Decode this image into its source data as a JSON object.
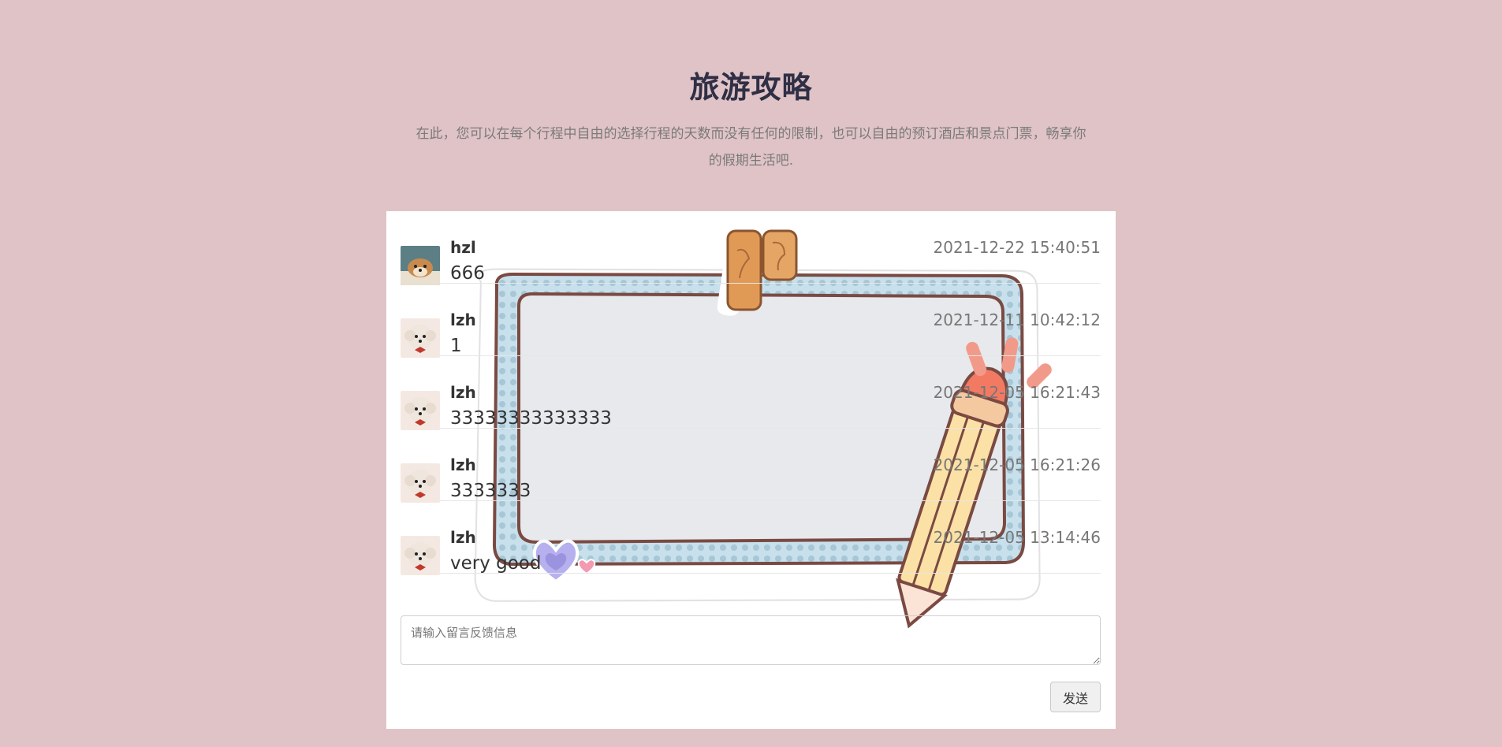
{
  "header": {
    "title": "旅游攻略",
    "subtitle": "在此，您可以在每个行程中自由的选择行程的天数而没有任何的限制，也可以自由的预订酒店和景点门票，畅享你的假期生活吧."
  },
  "messages": [
    {
      "user": "hzl",
      "text": "666",
      "time": "2021-12-22 15:40:51",
      "avatar": "shiba-dog-avatar"
    },
    {
      "user": "lzh",
      "text": "1",
      "time": "2021-12-11 10:42:12",
      "avatar": "poodle-avatar"
    },
    {
      "user": "lzh",
      "text": "33333333333333",
      "time": "2021-12-05 16:21:43",
      "avatar": "poodle-avatar"
    },
    {
      "user": "lzh",
      "text": "3333333",
      "time": "2021-12-05 16:21:26",
      "avatar": "poodle-avatar"
    },
    {
      "user": "lzh",
      "text": "very good",
      "time": "2021-12-05 13:14:46",
      "avatar": "poodle-avatar"
    }
  ],
  "form": {
    "placeholder": "请输入留言反馈信息",
    "send_label": "发送"
  },
  "colors": {
    "background": "#e0c3c6",
    "title": "#2f2f45",
    "board": "#ffffff"
  }
}
